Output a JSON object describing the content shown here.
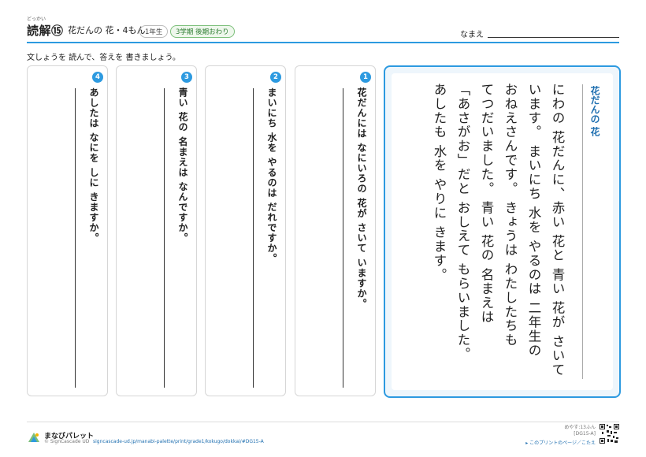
{
  "header": {
    "title_furigana": "どっかい",
    "title": "読解⑮",
    "subtitle": "花だんの 花・4もん",
    "grade_badge": "1年生",
    "term_badge": "3学期 後期おわり",
    "name_label": "なまえ"
  },
  "instruction": "文しょうを 読んで、答えを 書きましょう。",
  "story": {
    "title": "花だんの 花",
    "lines": [
      "にわの 花だんに、赤い 花と 青い 花が さいて",
      "います。 まいにち 水を やるのは 二年生の",
      "おねえさんです。 きょうは わたしたちも",
      "てつだいました。 青い 花の 名まえは",
      "「あさがお」だと おしえて もらいました。",
      "あしたも 水を やりに きます。"
    ]
  },
  "questions": [
    {
      "number": "1",
      "text": "花だんには なにいろの 花が さいて いますか。"
    },
    {
      "number": "2",
      "text": "まいにち 水を やるのは だれですか。"
    },
    {
      "number": "3",
      "text": "青い 花の 名まえは なんですか。"
    },
    {
      "number": "4",
      "text": "あしたは なにを しに きますか。"
    }
  ],
  "footer": {
    "brand": "まなびパレット",
    "copyright": "© SignCascade UD",
    "url": "signcascade-ud.jp/manabi-palette/print/grade1/kokugo/dokkai/#DG15-A",
    "time_label": "めやす:13ふん",
    "code": "[DG15-A]",
    "link_text": "▸ このプリントのページ／こたえ"
  },
  "colors": {
    "accent": "#2d9ae0",
    "term_badge": "#7cbf7a",
    "story_bg": "#eef6fc"
  }
}
